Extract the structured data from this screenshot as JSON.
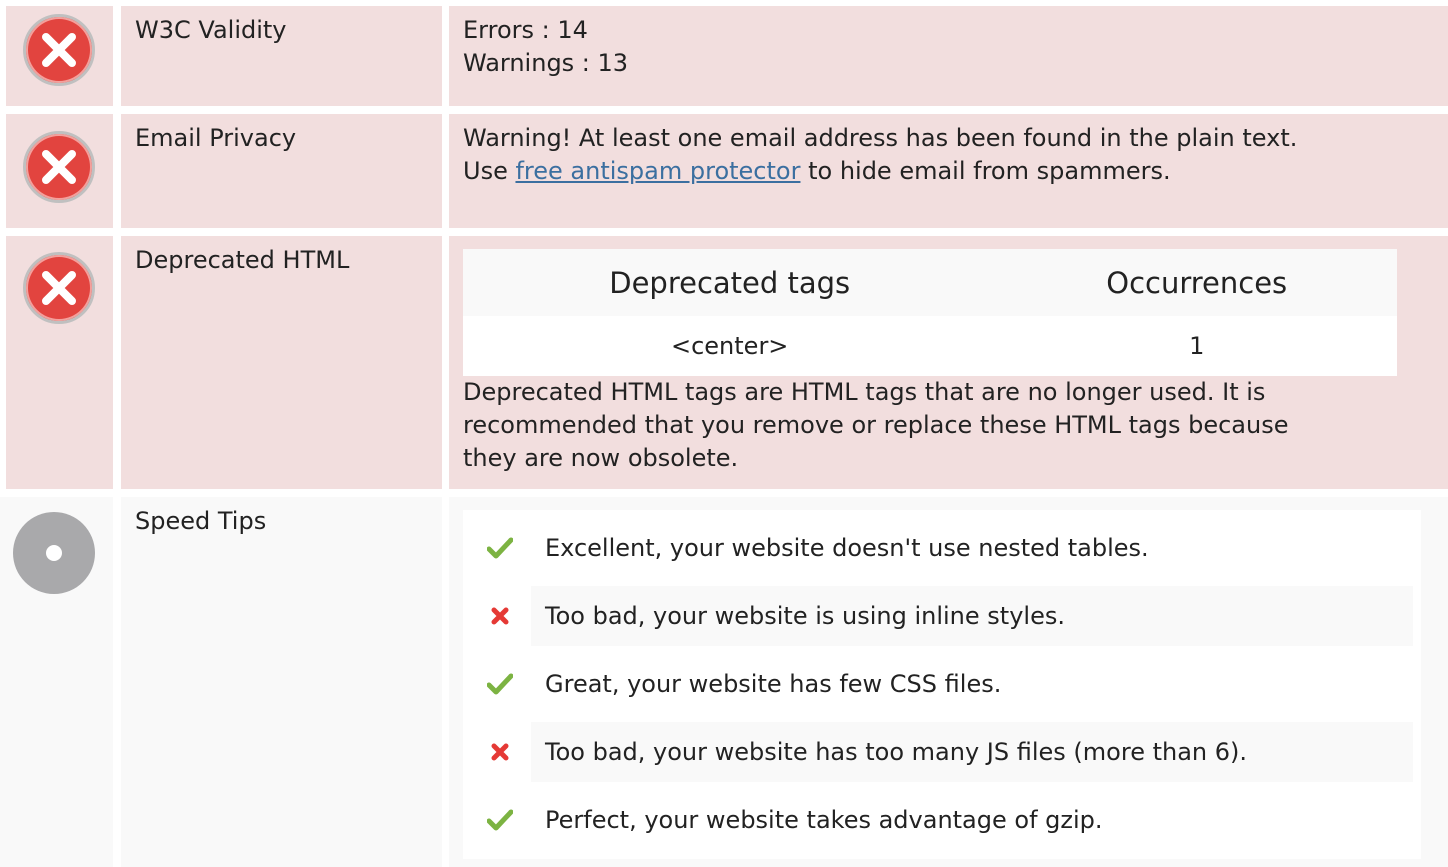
{
  "rows": {
    "w3c": {
      "label": "W3C Validity",
      "errors": "Errors : 14",
      "warnings": "Warnings : 13"
    },
    "email": {
      "label": "Email Privacy",
      "line1": "Warning! At least one email address has been found in the plain text.",
      "line2_prefix": "Use ",
      "line2_link": "free antispam protector",
      "line2_suffix": " to hide email from spammers."
    },
    "deprecated": {
      "label": "Deprecated HTML",
      "table": {
        "headers": [
          "Deprecated tags",
          "Occurrences"
        ],
        "rows": [
          [
            "<center>",
            "1"
          ]
        ]
      },
      "desc": [
        "Deprecated HTML tags are HTML tags that are no longer used. It is",
        "recommended that you remove or replace these HTML tags because",
        "they are now obsolete."
      ]
    },
    "speed": {
      "label": "Speed Tips",
      "tips": [
        {
          "status": "pass",
          "icon": "check-icon",
          "text": "Excellent, your website doesn't use nested tables."
        },
        {
          "status": "fail",
          "icon": "cross-icon",
          "text": "Too bad, your website is using inline styles."
        },
        {
          "status": "pass",
          "icon": "check-icon",
          "text": "Great, your website has few CSS files."
        },
        {
          "status": "fail",
          "icon": "cross-icon",
          "text": "Too bad, your website has too many JS files (more than 6)."
        },
        {
          "status": "pass",
          "icon": "check-icon",
          "text": "Perfect, your website takes advantage of gzip."
        }
      ]
    }
  },
  "colors": {
    "error_bg": "#f2dede",
    "neutral_bg": "#f9f9f9",
    "error_icon": "#e2443f",
    "pass_green": "#7cb342",
    "fail_red": "#e53935",
    "link": "#3b6fa0"
  }
}
